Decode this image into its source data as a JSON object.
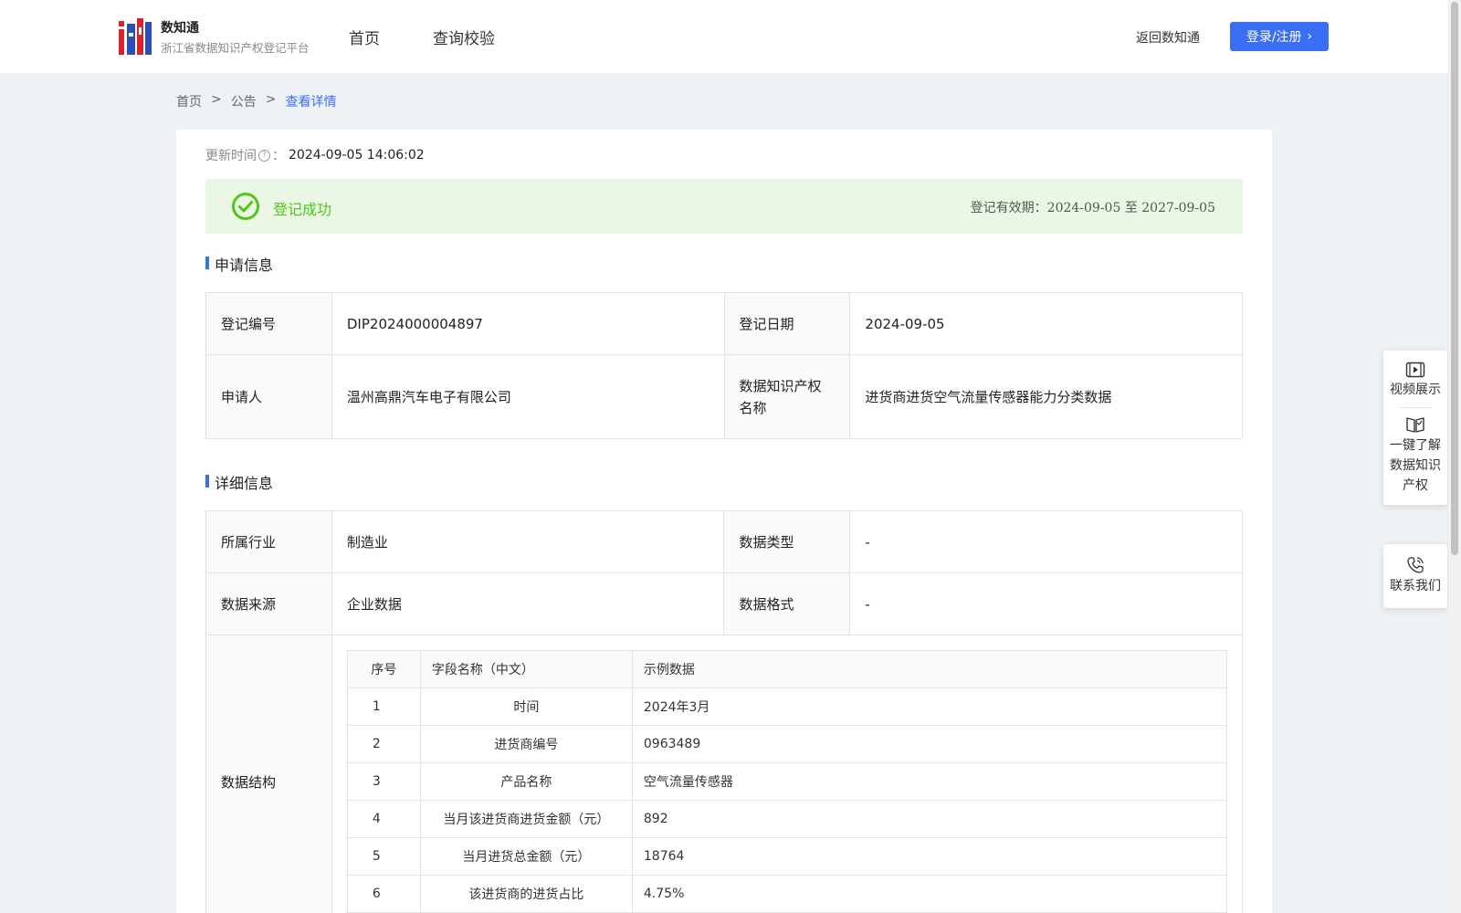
{
  "header": {
    "brand_name": "数知通",
    "brand_subtitle": "浙江省数据知识产权登记平台",
    "nav": [
      "首页",
      "查询校验"
    ],
    "back_link": "返回数知通",
    "login_button": "登录/注册"
  },
  "breadcrumb": {
    "items": [
      "首页",
      "公告",
      "查看详情"
    ],
    "separator": ">"
  },
  "update": {
    "label": "更新时间",
    "colon": "：",
    "value": "2024-09-05 14:06:02"
  },
  "status": {
    "text": "登记成功",
    "validity_label": "登记有效期：",
    "validity_range": "2024-09-05 至 2027-09-05",
    "color": "#52c41a"
  },
  "application": {
    "title": "申请信息",
    "reg_no_label": "登记编号",
    "reg_no": "DIP2024000004897",
    "reg_date_label": "登记日期",
    "reg_date": "2024-09-05",
    "applicant_label": "申请人",
    "applicant": "温州高鼎汽车电子有限公司",
    "ip_name_label": "数据知识产权名称",
    "ip_name": "进货商进货空气流量传感器能力分类数据"
  },
  "details": {
    "title": "详细信息",
    "industry_label": "所属行业",
    "industry": "制造业",
    "data_type_label": "数据类型",
    "data_type": "-",
    "source_label": "数据来源",
    "source": "企业数据",
    "format_label": "数据格式",
    "format": "-",
    "structure_label": "数据结构",
    "structure_headers": [
      "序号",
      "字段名称（中文）",
      "示例数据"
    ],
    "structure_rows": [
      {
        "no": "1",
        "name": "时间",
        "example": "2024年3月"
      },
      {
        "no": "2",
        "name": "进货商编号",
        "example": "0963489"
      },
      {
        "no": "3",
        "name": "产品名称",
        "example": "空气流量传感器"
      },
      {
        "no": "4",
        "name": "当月该进货商进货金额（元）",
        "example": "892"
      },
      {
        "no": "5",
        "name": "当月进货总金额（元）",
        "example": "18764"
      },
      {
        "no": "6",
        "name": "该进货商的进货占比",
        "example": "4.75%"
      }
    ]
  },
  "side_panel": {
    "video": "视频展示",
    "learn": "一键了解数据知识产权",
    "contact": "联系我们"
  },
  "colors": {
    "accent": "#3a6ff4",
    "success": "#52c41a",
    "success_bg": "#e9f7e4"
  }
}
